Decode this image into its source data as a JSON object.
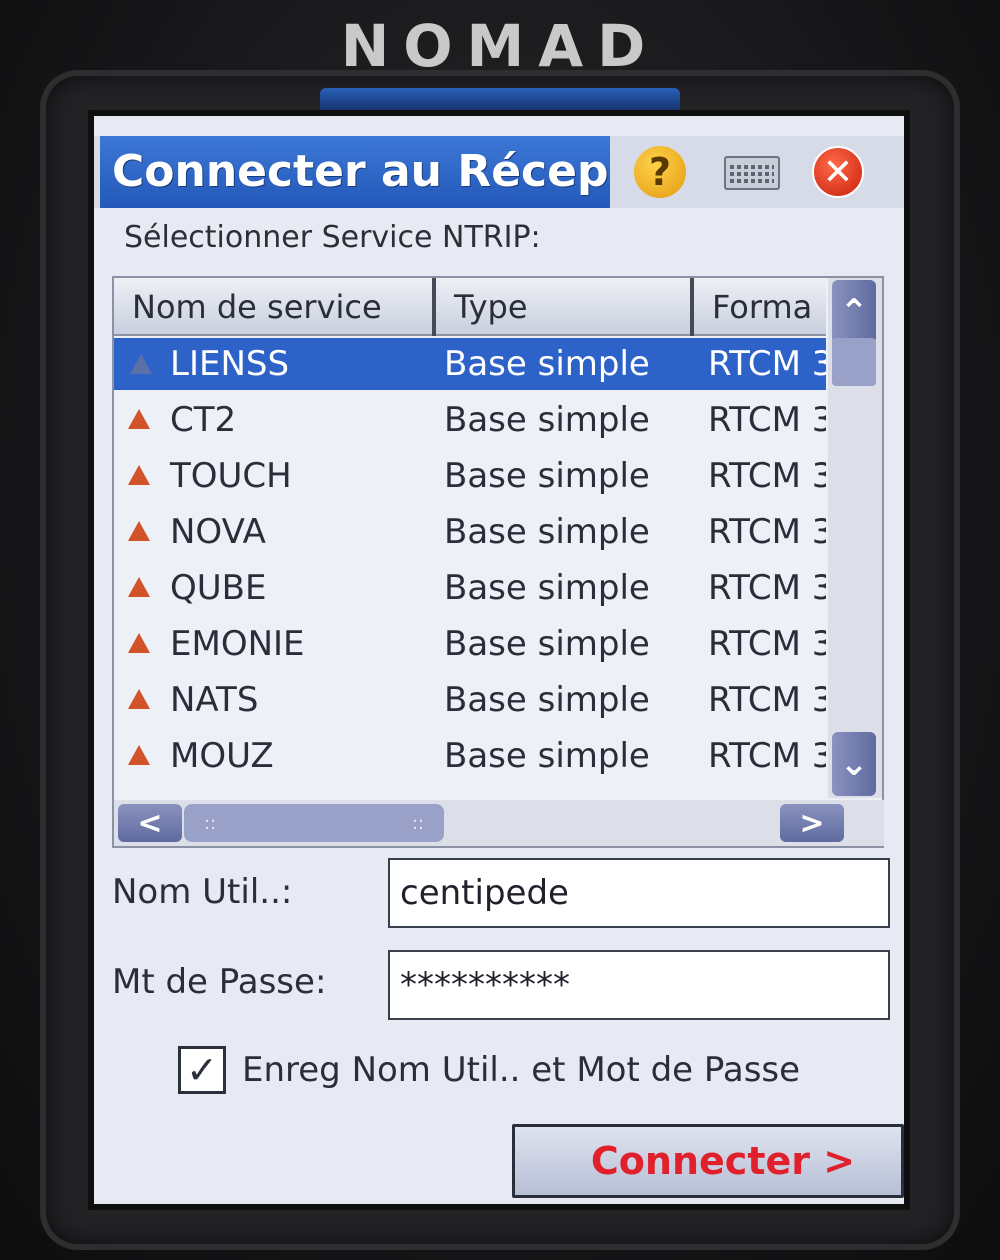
{
  "device": {
    "brand": "NOMAD"
  },
  "window": {
    "title": "Connecter au Récep",
    "help_icon": "?",
    "close_icon": "✕"
  },
  "select_label": "Sélectionner Service NTRIP:",
  "table": {
    "columns": [
      "Nom de service",
      "Type",
      "Forma"
    ],
    "rows": [
      {
        "name": "LIENSS",
        "type": "Base simple",
        "format": "RTCM 3",
        "selected": true
      },
      {
        "name": "CT2",
        "type": "Base simple",
        "format": "RTCM 3"
      },
      {
        "name": "TOUCH",
        "type": "Base simple",
        "format": "RTCM 3"
      },
      {
        "name": "NOVA",
        "type": "Base simple",
        "format": "RTCM 3"
      },
      {
        "name": "QUBE",
        "type": "Base simple",
        "format": "RTCM 3"
      },
      {
        "name": "EMONIE",
        "type": "Base simple",
        "format": "RTCM 3"
      },
      {
        "name": "NATS",
        "type": "Base simple",
        "format": "RTCM 3"
      },
      {
        "name": "MOUZ",
        "type": "Base simple",
        "format": "RTCM 3"
      }
    ],
    "scroll_up": "⌃",
    "scroll_down": "⌄",
    "scroll_left": "<",
    "scroll_right": ">",
    "grip": "::"
  },
  "form": {
    "username_label": "Nom Util..:",
    "username_value": "centipede",
    "password_label": "Mt de Passe:",
    "password_value": "**********",
    "remember_label": "Enreg Nom Util.. et Mot de Passe",
    "remember_checked": true,
    "checkmark": "✓"
  },
  "connect_button": "Connecter >",
  "colors": {
    "title_bar": "#2d63c8",
    "selection": "#2d63c8",
    "connect_text": "#e0202a",
    "warning_triangle": "#d2522a"
  }
}
